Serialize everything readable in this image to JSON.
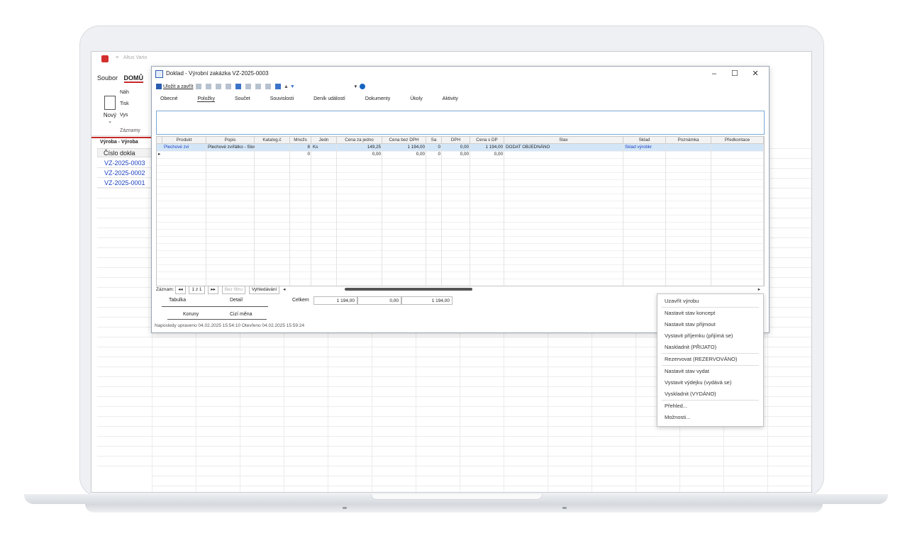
{
  "app": {
    "title": "Altus Vario",
    "ribbon_tabs": [
      "Soubor",
      "DOMŮ"
    ],
    "ribbon_new": "Nový",
    "ribbon_items": [
      "Náh",
      "Tisk",
      "Vys"
    ],
    "ribbon_group": "Záznamy",
    "left_tab": "Výroba - Výroba",
    "left_column": "Číslo dokla",
    "left_rows": [
      "VZ-2025-0003",
      "VZ-2025-0002",
      "VZ-2025-0001"
    ]
  },
  "dialog": {
    "title": "Doklad - Výrobní zakázka VZ-2025-0003",
    "window_buttons": [
      "–",
      "☐",
      "✕"
    ],
    "toolbar_save": "Uložit a zavřít",
    "tabs": [
      "Obecné",
      "Položky",
      "Součet",
      "Souvislosti",
      "Deník událostí",
      "Dokumenty",
      "Úkoly",
      "Aktivity"
    ],
    "grid": {
      "columns": [
        "Produkt",
        "Popis",
        "Katalog.č",
        "Množs",
        "Jedn",
        "Cena za jedno",
        "Cena bez DPH",
        "Sa",
        "DPH",
        "Cena s DP",
        "Stav",
        "Sklad",
        "Poznámka",
        "Předkontace"
      ],
      "row1": [
        "Plechové zvi",
        "Plechové zvířátko - Slon",
        "",
        "8",
        "Ks",
        "149,25",
        "1 194,00",
        "0",
        "0,00",
        "1 194,00",
        "DODAT OBJEDNÁNO",
        "Sklad výrobkr",
        "",
        ""
      ],
      "row2": [
        "",
        "",
        "",
        "0",
        "",
        "0,00",
        "0,00",
        "0",
        "0,00",
        "0,00",
        "",
        "",
        "",
        ""
      ]
    },
    "nav": {
      "label": "Záznam:",
      "position": "1 z 1",
      "filter": "Bez filtru",
      "search": "Vyhledávání"
    },
    "bottom_tabs": [
      "Tabulka",
      "Detail"
    ],
    "currency_tabs": [
      "Koruny",
      "Cizí měna"
    ],
    "totals_label": "Celkem",
    "totals": [
      "1 194,00",
      "0,00",
      "1 194,00"
    ],
    "status": "Naposledy upraveno 04.02.2025 15:54:10 Otevřeno 04.02.2025 15:59:24"
  },
  "context_menu": {
    "items": [
      "Uzavřít výrobu",
      "Nastavit stav koncept",
      "Nastavit stav přijmout",
      "Vystavit příjemku (přijímá se)",
      "Naskladnit (PŘIJATO)",
      "Rezervovat (REZERVOVÁNO)",
      "Nastavit stav vydat",
      "Vystavit výdejku (vydává se)",
      "Vyskladnit (VYDÁNO)",
      "Přehled...",
      "Možnosti..."
    ]
  }
}
